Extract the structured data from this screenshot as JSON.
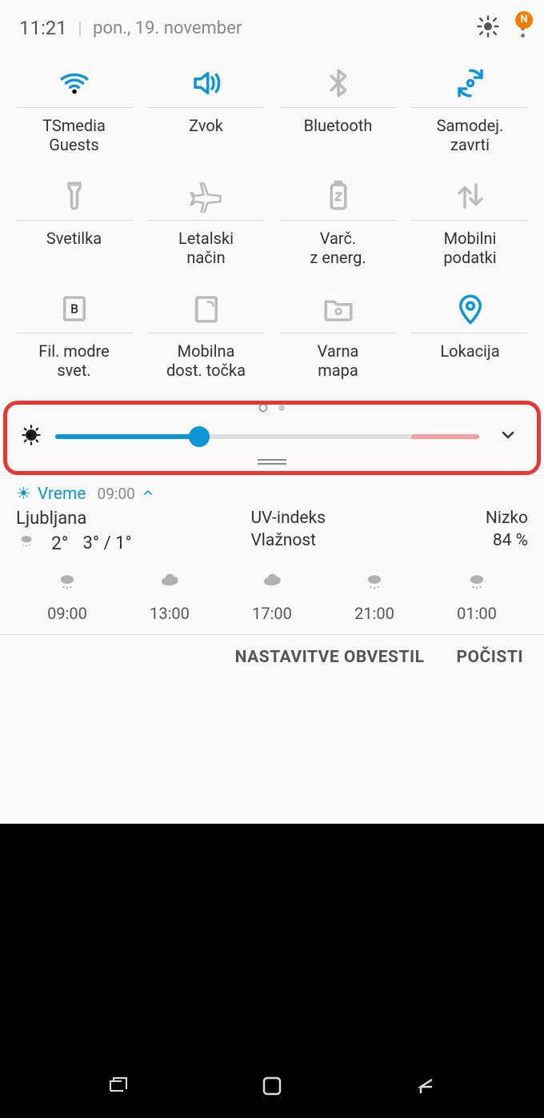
{
  "header": {
    "time": "11:21",
    "date": "pon., 19. november",
    "badge": "N"
  },
  "tiles": [
    {
      "label": "TSmedia\nGuests",
      "name": "wifi",
      "active": true,
      "icon": "wifi"
    },
    {
      "label": "Zvok",
      "name": "sound",
      "active": true,
      "icon": "sound"
    },
    {
      "label": "Bluetooth",
      "name": "bluetooth",
      "active": false,
      "icon": "bt"
    },
    {
      "label": "Samodej.\nzavrti",
      "name": "autorotate",
      "active": true,
      "icon": "rotate"
    },
    {
      "label": "Svetilka",
      "name": "flashlight",
      "active": false,
      "icon": "torch"
    },
    {
      "label": "Letalski\nnačin",
      "name": "airplane",
      "active": false,
      "icon": "plane"
    },
    {
      "label": "Varč.\nz energ.",
      "name": "powersave",
      "active": false,
      "icon": "battery"
    },
    {
      "label": "Mobilni\npodatki",
      "name": "mobiledata",
      "active": false,
      "icon": "updown"
    },
    {
      "label": "Fil. modre\nsvet.",
      "name": "bluefilter",
      "active": false,
      "icon": "bfilter"
    },
    {
      "label": "Mobilna\ndost. točka",
      "name": "hotspot",
      "active": false,
      "icon": "hotspot"
    },
    {
      "label": "Varna\nmapa",
      "name": "securefolder",
      "active": false,
      "icon": "folder"
    },
    {
      "label": "Lokacija",
      "name": "location",
      "active": true,
      "icon": "pin"
    }
  ],
  "brightness": {
    "percent": 34
  },
  "weather": {
    "label": "Vreme",
    "time": "09:00",
    "city": "Ljubljana",
    "current": "2°",
    "highlow": "3° / 1°",
    "uv_label": "UV-indeks",
    "hum_label": "Vlažnost",
    "uv_value": "Nizko",
    "hum_value": "84 %",
    "forecast": [
      {
        "time": "09:00"
      },
      {
        "time": "13:00"
      },
      {
        "time": "17:00"
      },
      {
        "time": "21:00"
      },
      {
        "time": "01:00"
      }
    ]
  },
  "buttons": {
    "settings": "NASTAVITVE OBVESTIL",
    "clear": "POČISTI"
  }
}
